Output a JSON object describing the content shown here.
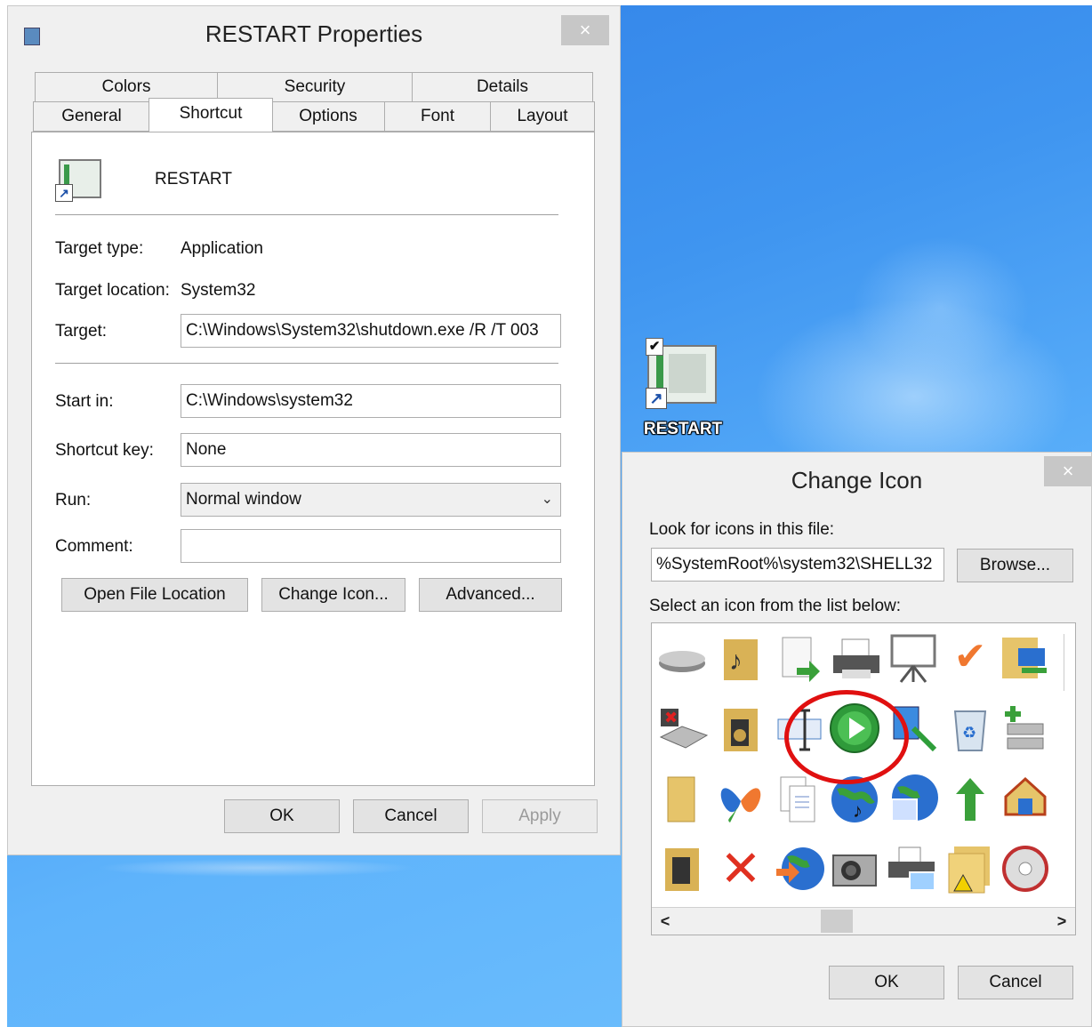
{
  "desktop": {
    "shortcut_label": "RESTART"
  },
  "properties": {
    "title": "RESTART Properties",
    "close_glyph": "×",
    "tabs_row1": [
      "Colors",
      "Security",
      "Details"
    ],
    "tabs_row2": [
      "General",
      "Shortcut",
      "Options",
      "Font",
      "Layout"
    ],
    "active_tab": "Shortcut",
    "app_name": "RESTART",
    "target_type_label": "Target type:",
    "target_type_value": "Application",
    "target_location_label": "Target location:",
    "target_location_value": "System32",
    "target_label": "Target:",
    "target_value": "C:\\Windows\\System32\\shutdown.exe /R /T 003",
    "start_in_label": "Start in:",
    "start_in_value": "C:\\Windows\\system32",
    "shortcut_key_label": "Shortcut key:",
    "shortcut_key_value": "None",
    "run_label": "Run:",
    "run_value": "Normal window",
    "comment_label": "Comment:",
    "comment_value": "",
    "open_file_location": "Open File Location",
    "change_icon": "Change Icon...",
    "advanced": "Advanced...",
    "ok": "OK",
    "cancel": "Cancel",
    "apply": "Apply"
  },
  "change_icon": {
    "title": "Change Icon",
    "close_glyph": "×",
    "look_for_label": "Look for icons in this file:",
    "file_value": "%SystemRoot%\\system32\\SHELL32",
    "browse": "Browse...",
    "select_label": "Select an icon from the list below:",
    "icons": [
      [
        "drive-icon",
        "music-folder-icon",
        "file-move-icon",
        "printer-icon",
        "projector-icon",
        "checkmark-icon",
        "network-folder-icon"
      ],
      [
        "drive-error-icon",
        "speaker-folder-icon",
        "text-cursor-icon",
        "play-icon",
        "search-icon",
        "recycle-bin-icon",
        "network-add-icon"
      ],
      [
        "folder-icon",
        "butterfly-icon",
        "documents-icon",
        "globe-music-icon",
        "globe-picture-icon",
        "up-arrow-icon",
        "home-network-icon"
      ],
      [
        "media-folder-icon",
        "red-x-icon",
        "globe-arrow-icon",
        "camera-icon",
        "scanner-icon",
        "folder-warning-icon",
        "disc-icon"
      ]
    ],
    "scroll_left": "<",
    "scroll_right": ">",
    "ok": "OK",
    "cancel": "Cancel"
  }
}
